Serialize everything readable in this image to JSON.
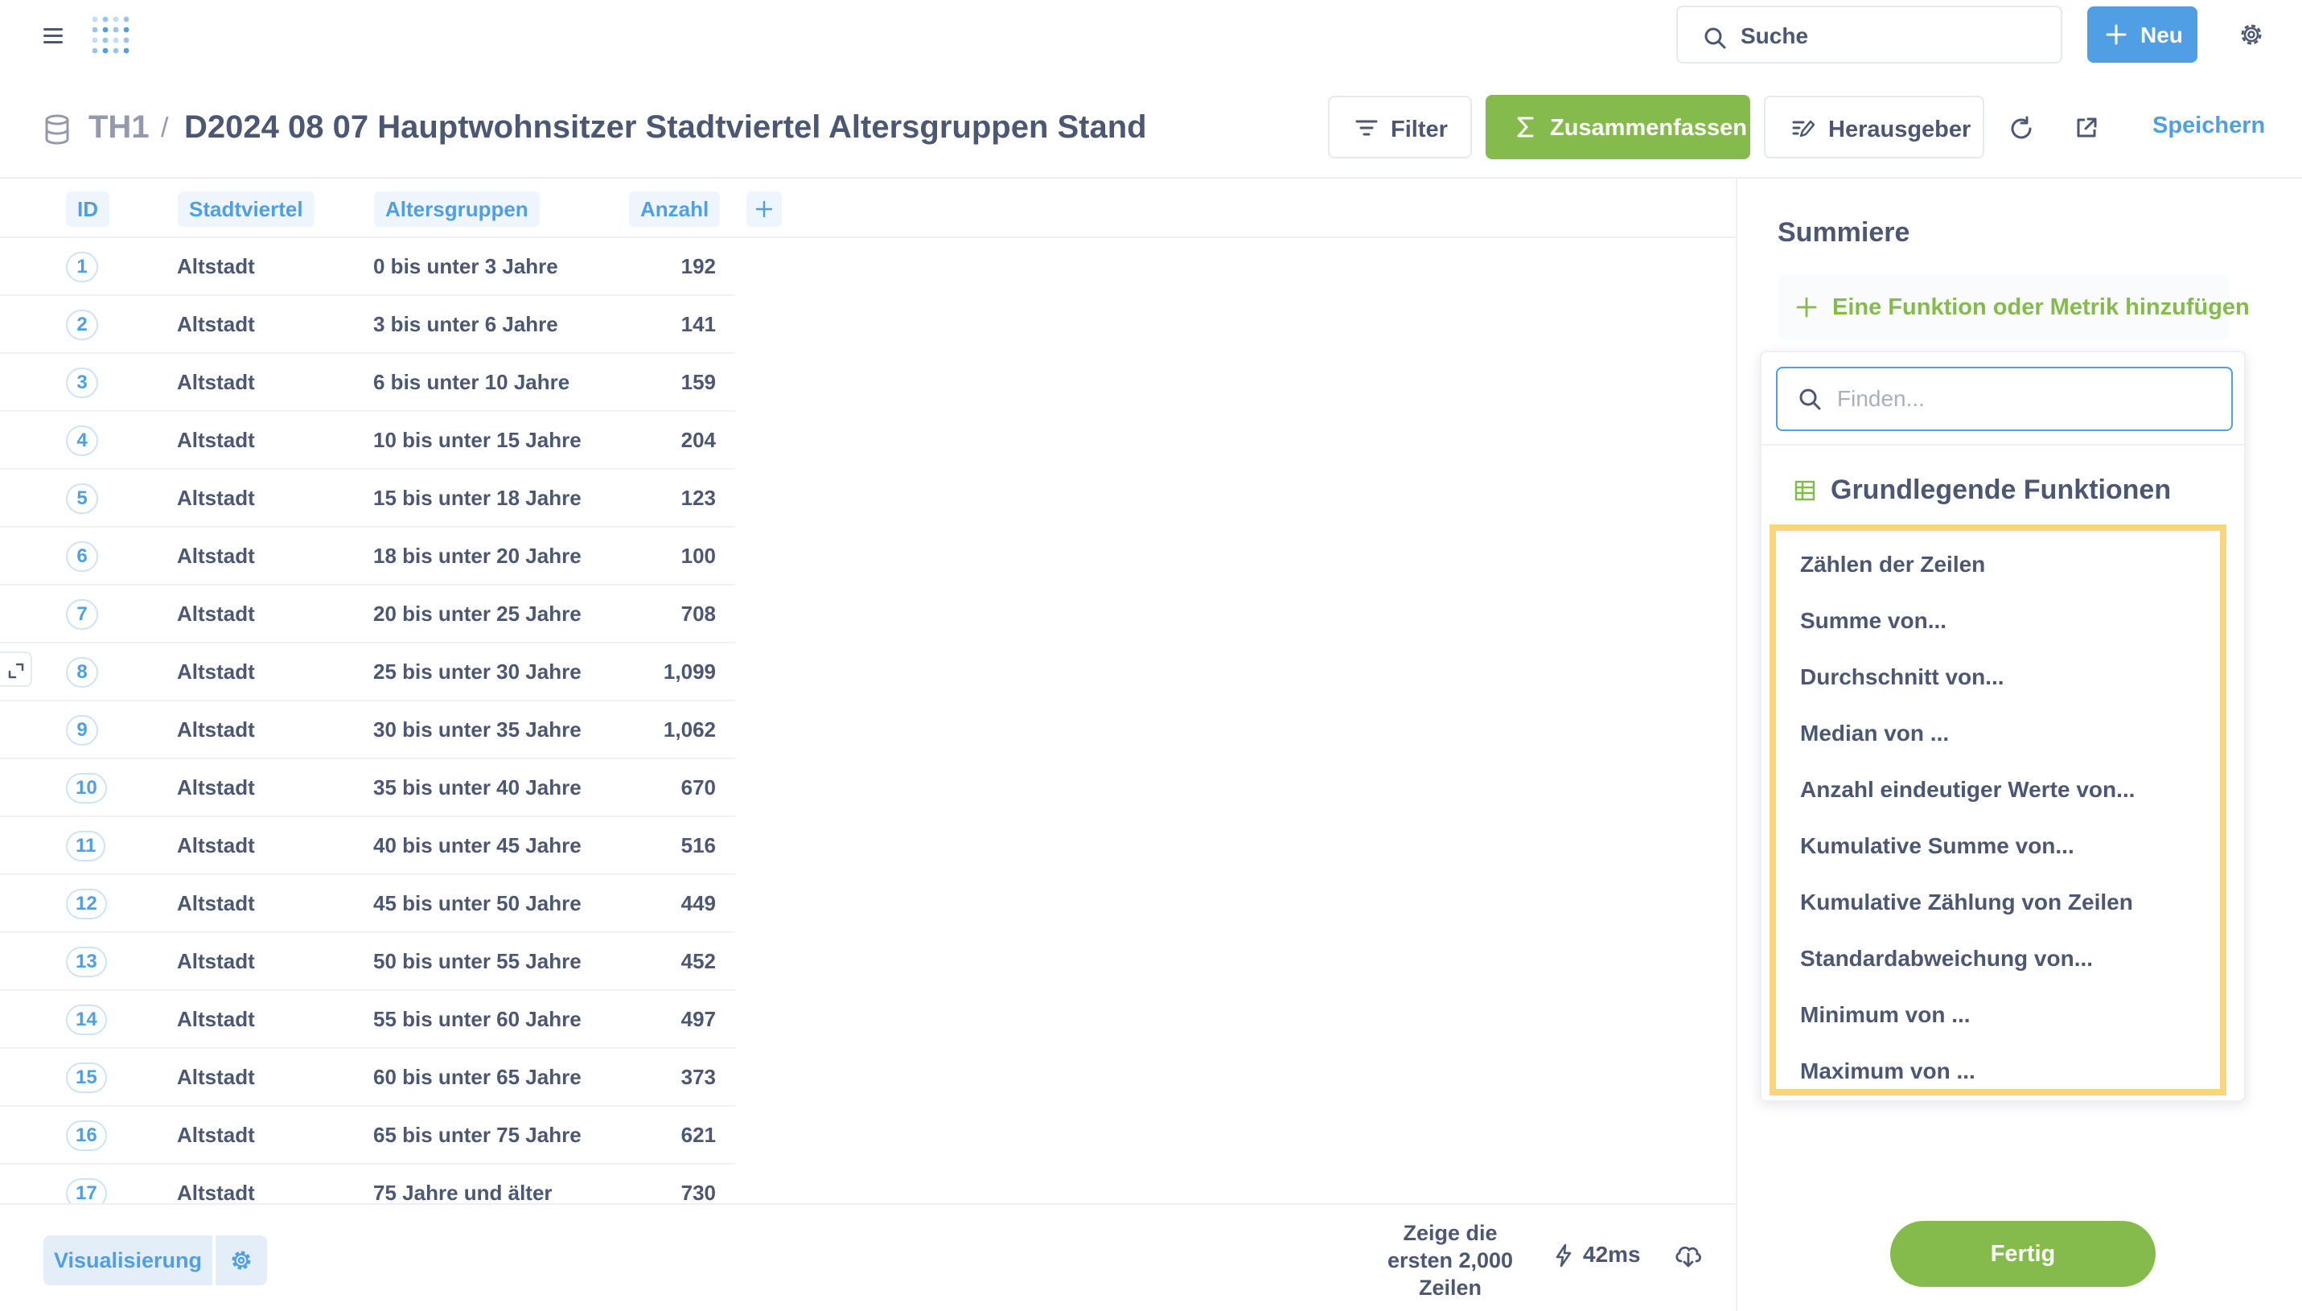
{
  "topnav": {
    "search_label": "Suche",
    "new_label": "Neu"
  },
  "header": {
    "breadcrumb_root": "TH1",
    "breadcrumb_sep": "/",
    "title": "D2024 08 07 Hauptwohnsitzer Stadtviertel Altersgruppen Stand",
    "filter_label": "Filter",
    "summarize_label": "Zusammenfassen",
    "editor_label": "Herausgeber",
    "save_label": "Speichern"
  },
  "table": {
    "columns": [
      "ID",
      "Stadtviertel",
      "Altersgruppen",
      "Anzahl"
    ],
    "rows": [
      {
        "id": "1",
        "district": "Altstadt",
        "age": "0 bis unter 3 Jahre",
        "count": "192"
      },
      {
        "id": "2",
        "district": "Altstadt",
        "age": "3 bis unter 6 Jahre",
        "count": "141"
      },
      {
        "id": "3",
        "district": "Altstadt",
        "age": "6 bis unter 10 Jahre",
        "count": "159"
      },
      {
        "id": "4",
        "district": "Altstadt",
        "age": "10 bis unter 15 Jahre",
        "count": "204"
      },
      {
        "id": "5",
        "district": "Altstadt",
        "age": "15 bis unter 18 Jahre",
        "count": "123"
      },
      {
        "id": "6",
        "district": "Altstadt",
        "age": "18 bis unter 20 Jahre",
        "count": "100"
      },
      {
        "id": "7",
        "district": "Altstadt",
        "age": "20 bis unter 25 Jahre",
        "count": "708"
      },
      {
        "id": "8",
        "district": "Altstadt",
        "age": "25 bis unter 30 Jahre",
        "count": "1,099"
      },
      {
        "id": "9",
        "district": "Altstadt",
        "age": "30 bis unter 35 Jahre",
        "count": "1,062"
      },
      {
        "id": "10",
        "district": "Altstadt",
        "age": "35 bis unter 40 Jahre",
        "count": "670"
      },
      {
        "id": "11",
        "district": "Altstadt",
        "age": "40 bis unter 45 Jahre",
        "count": "516"
      },
      {
        "id": "12",
        "district": "Altstadt",
        "age": "45 bis unter 50 Jahre",
        "count": "449"
      },
      {
        "id": "13",
        "district": "Altstadt",
        "age": "50 bis unter 55 Jahre",
        "count": "452"
      },
      {
        "id": "14",
        "district": "Altstadt",
        "age": "55 bis unter 60 Jahre",
        "count": "497"
      },
      {
        "id": "15",
        "district": "Altstadt",
        "age": "60 bis unter 65 Jahre",
        "count": "373"
      },
      {
        "id": "16",
        "district": "Altstadt",
        "age": "65 bis unter 75 Jahre",
        "count": "621"
      },
      {
        "id": "17",
        "district": "Altstadt",
        "age": "75 Jahre und älter",
        "count": "730"
      }
    ]
  },
  "footer": {
    "visualization_label": "Visualisierung",
    "rowcount_line1": "Zeige die",
    "rowcount_line2": "ersten 2,000",
    "rowcount_line3": "Zeilen",
    "timing": "42ms"
  },
  "sidebar": {
    "title": "Summiere",
    "add_metric_label": "Eine Funktion oder Metrik hinzufügen",
    "find_placeholder": "Finden...",
    "section_title": "Grundlegende Funktionen",
    "functions": [
      "Zählen der Zeilen",
      "Summe von...",
      "Durchschnitt von...",
      "Median von ...",
      "Anzahl eindeutiger Werte von...",
      "Kumulative Summe von...",
      "Kumulative Zählung von Zeilen",
      "Standardabweichung von...",
      "Minimum von ...",
      "Maximum von ..."
    ],
    "done_label": "Fertig"
  },
  "colors": {
    "brand_blue": "#509ee3",
    "summarize_green": "#84bb4c",
    "highlight_yellow": "#f9d57e",
    "text": "#4c5773"
  },
  "icons": [
    "hamburger-icon",
    "logo-icon",
    "search-icon",
    "plus-icon",
    "gear-icon",
    "database-icon",
    "filter-icon",
    "sigma-icon",
    "notebook-icon",
    "refresh-icon",
    "open-external-icon",
    "expand-icon",
    "bolt-icon",
    "download-icon",
    "table-icon"
  ]
}
